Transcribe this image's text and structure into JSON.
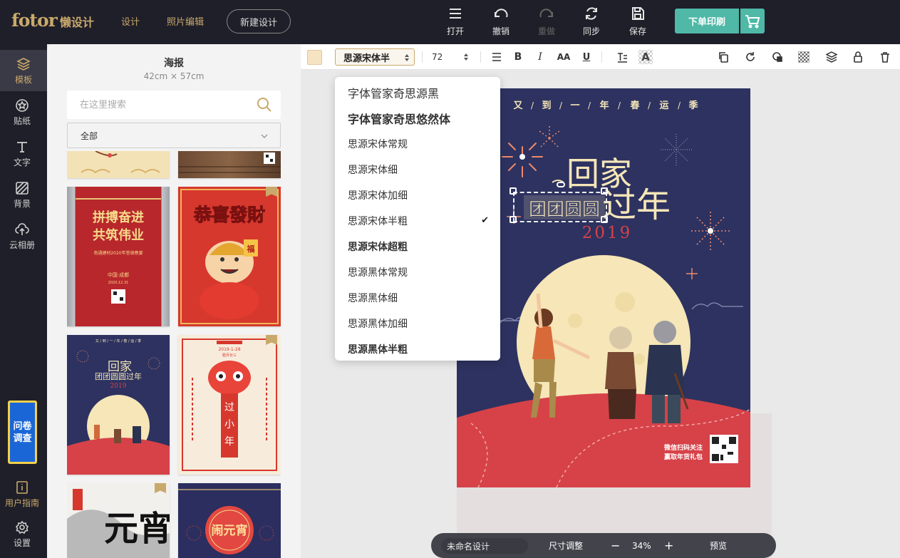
{
  "app": {
    "logo_text": "fotor",
    "logo_cn": "懒设计",
    "brand_color": "#c9a96b",
    "accent_color": "#4fb8a7"
  },
  "topbar": {
    "nav": [
      {
        "label": "设计"
      },
      {
        "label": "照片编辑"
      }
    ],
    "new_design": "新建设计",
    "tools": [
      {
        "label": "打开",
        "icon": "menu-icon"
      },
      {
        "label": "撤销",
        "icon": "undo-icon"
      },
      {
        "label": "重做",
        "icon": "redo-icon",
        "disabled": true
      },
      {
        "label": "同步",
        "icon": "sync-icon"
      },
      {
        "label": "保存",
        "icon": "save-icon"
      }
    ],
    "print_label": "下单印刷"
  },
  "sidenav": {
    "items": [
      {
        "label": "模板",
        "icon": "layers-icon"
      },
      {
        "label": "贴纸",
        "icon": "sticker-icon"
      },
      {
        "label": "文字",
        "icon": "text-icon"
      },
      {
        "label": "背景",
        "icon": "background-icon"
      },
      {
        "label": "云相册",
        "icon": "cloud-upload-icon"
      }
    ],
    "survey": "问卷调查",
    "bottom": [
      {
        "label": "用户指南",
        "icon": "info-icon"
      },
      {
        "label": "设置",
        "icon": "settings-icon"
      }
    ]
  },
  "panel": {
    "title": "海报",
    "size": "42cm × 57cm",
    "search_placeholder": "在这里搜索",
    "category": "全部",
    "templates": [
      {
        "t1": "拼搏奋进",
        "t2": "共筑伟业",
        "small": "南通建材2020年答谢晚宴",
        "footer": "中国·成都",
        "date": "2020.12.31"
      },
      {
        "t1": "恭喜發財"
      },
      {
        "t1": "回家",
        "t2": "团团圆圆过年",
        "t3": "2019"
      },
      {
        "t1": "过",
        "t2": "小",
        "t3": "年",
        "top": "2019-1-28",
        "sub": "腊月廿三"
      },
      {
        "t1": "元宵"
      },
      {
        "t1": "闹元宵"
      }
    ]
  },
  "format": {
    "font": "思源宋体半",
    "size": "72",
    "bold": "B",
    "italic": "I",
    "caps": "AA",
    "underline": "U",
    "text_color_icon": "A"
  },
  "font_dropdown": {
    "items": [
      "字体管家奇思源黑",
      "字体管家奇思悠然体",
      "思源宋体常规",
      "思源宋体细",
      "思源宋体加细",
      "思源宋体半粗",
      "思源宋体超粗",
      "思源黑体常规",
      "思源黑体细",
      "思源黑体加细",
      "思源黑体半粗"
    ],
    "selected": 5,
    "check": "✔"
  },
  "poster": {
    "top_slogan": [
      "又",
      "到",
      "一",
      "年",
      "春",
      "运",
      "季"
    ],
    "title1": "回家",
    "title2": "过年",
    "highlight": "团团圆圆",
    "year": "2019",
    "qr_caption1": "微信扫码关注",
    "qr_caption2": "赢取年货礼包",
    "bg_color": "#2d3260",
    "moon_color": "#f6e6b8",
    "ground_color": "#d64248"
  },
  "bottombar": {
    "name": "未命名设计",
    "resize": "尺寸调整",
    "minus": "−",
    "zoom": "34%",
    "plus": "+",
    "preview": "预览"
  }
}
